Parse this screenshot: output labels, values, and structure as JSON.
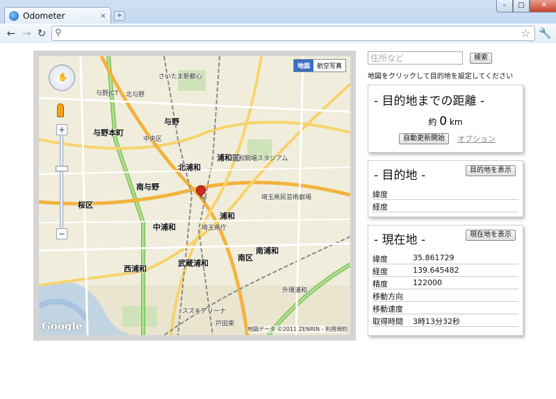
{
  "browser": {
    "tab_title": "Odometer",
    "tab_close": "×",
    "new_tab": "+",
    "win_min": "–",
    "win_max": "□",
    "win_close": "✕",
    "back": "←",
    "forward": "→",
    "reload": "↻",
    "url": "",
    "star": "☆",
    "menu": "🔧"
  },
  "map": {
    "type_map": "地図",
    "type_satellite": "航空写真",
    "zoom_in": "+",
    "zoom_out": "−",
    "logo": "Google",
    "copyright": "地図データ ©2011 ZENRIN - 利用規約",
    "labels": [
      {
        "text": "さいたま新都心"
      },
      {
        "text": "北与野"
      },
      {
        "text": "与野JCT"
      },
      {
        "text": "与野"
      },
      {
        "text": "与野本町"
      },
      {
        "text": "中央区"
      },
      {
        "text": "浦和区",
        "big": true
      },
      {
        "text": "北浦和"
      },
      {
        "text": "南与野"
      },
      {
        "text": "桜区",
        "big": true
      },
      {
        "text": "中浦和"
      },
      {
        "text": "浦和"
      },
      {
        "text": "埼玉県庁"
      },
      {
        "text": "西浦和"
      },
      {
        "text": "武蔵浦和"
      },
      {
        "text": "南区",
        "big": true
      },
      {
        "text": "南浦和"
      },
      {
        "text": "浦和駒場スタジアム"
      },
      {
        "text": "外環浦和"
      },
      {
        "text": "戸田東"
      },
      {
        "text": "スズキアリーナ"
      },
      {
        "text": "埼玉県民芸術劇場"
      }
    ]
  },
  "search": {
    "placeholder": "住所など",
    "button": "検索",
    "hint": "地図をクリックして目的地を設定してください"
  },
  "distance": {
    "title": "- 目的地までの距離 -",
    "prefix": "約",
    "value": "0",
    "unit": "km",
    "auto_update_button": "自動更新開始",
    "options_link": "オプション"
  },
  "destination": {
    "title": "- 目的地 -",
    "show_button": "目的地を表示",
    "rows": [
      {
        "label": "緯度",
        "value": ""
      },
      {
        "label": "経度",
        "value": ""
      }
    ]
  },
  "current": {
    "title": "- 現在地 -",
    "show_button": "現在地を表示",
    "rows": [
      {
        "label": "緯度",
        "value": "35.861729"
      },
      {
        "label": "経度",
        "value": "139.645482"
      },
      {
        "label": "精度",
        "value": "122000"
      },
      {
        "label": "移動方向",
        "value": ""
      },
      {
        "label": "移動速度",
        "value": ""
      },
      {
        "label": "取得時間",
        "value": "3時13分32秒"
      }
    ]
  }
}
